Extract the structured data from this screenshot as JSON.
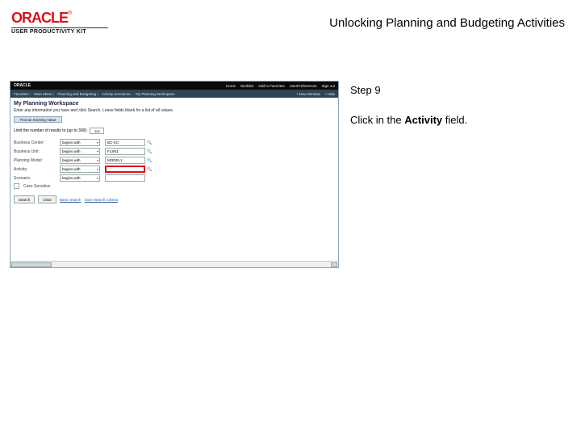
{
  "header": {
    "vendor": "ORACLE",
    "tm": "®",
    "product_line": "USER PRODUCTIVITY KIT",
    "title": "Unlocking Planning and Budgeting Activities"
  },
  "instruction": {
    "step_label": "Step 9",
    "line_prefix": "Click in the ",
    "field_bold": "Activity",
    "line_suffix": " field."
  },
  "shot": {
    "brand": "ORACLE",
    "top_menus": [
      "Home",
      "Worklist",
      "Add to Favorites",
      "UserPreferences",
      "Sign out"
    ],
    "crumbs": [
      "Favorites",
      "Main Menu",
      "Planning and Budgeting",
      "Activity Scenarios",
      "My Planning Workspace"
    ],
    "utils": [
      "New Window",
      "Help"
    ],
    "page_title": "My Planning Workspace",
    "sub": "Enter any information you have and click Search. Leave fields blank for a list of all values.",
    "tab": "Find an Existing Value",
    "limit_label": "Limit the number of results to (up to 300):",
    "limit_value": "300",
    "rows": {
      "business_center": {
        "label": "Business Center:",
        "op": "begins with",
        "val": "BC-CC"
      },
      "business_unit": {
        "label": "Business Unit:",
        "op": "begins with",
        "val": "FLSN1"
      },
      "planning_model": {
        "label": "Planning Model:",
        "op": "begins with",
        "val": "MODEL1"
      },
      "activity": {
        "label": "Activity:",
        "op": "begins with"
      },
      "scenario": {
        "label": "Scenario:",
        "op": "begins with"
      }
    },
    "case_label": "Case Sensitive",
    "btn_search": "Search",
    "btn_clear": "Clear",
    "link_basic": "Basic Search",
    "link_save": "Save Search Criteria"
  }
}
